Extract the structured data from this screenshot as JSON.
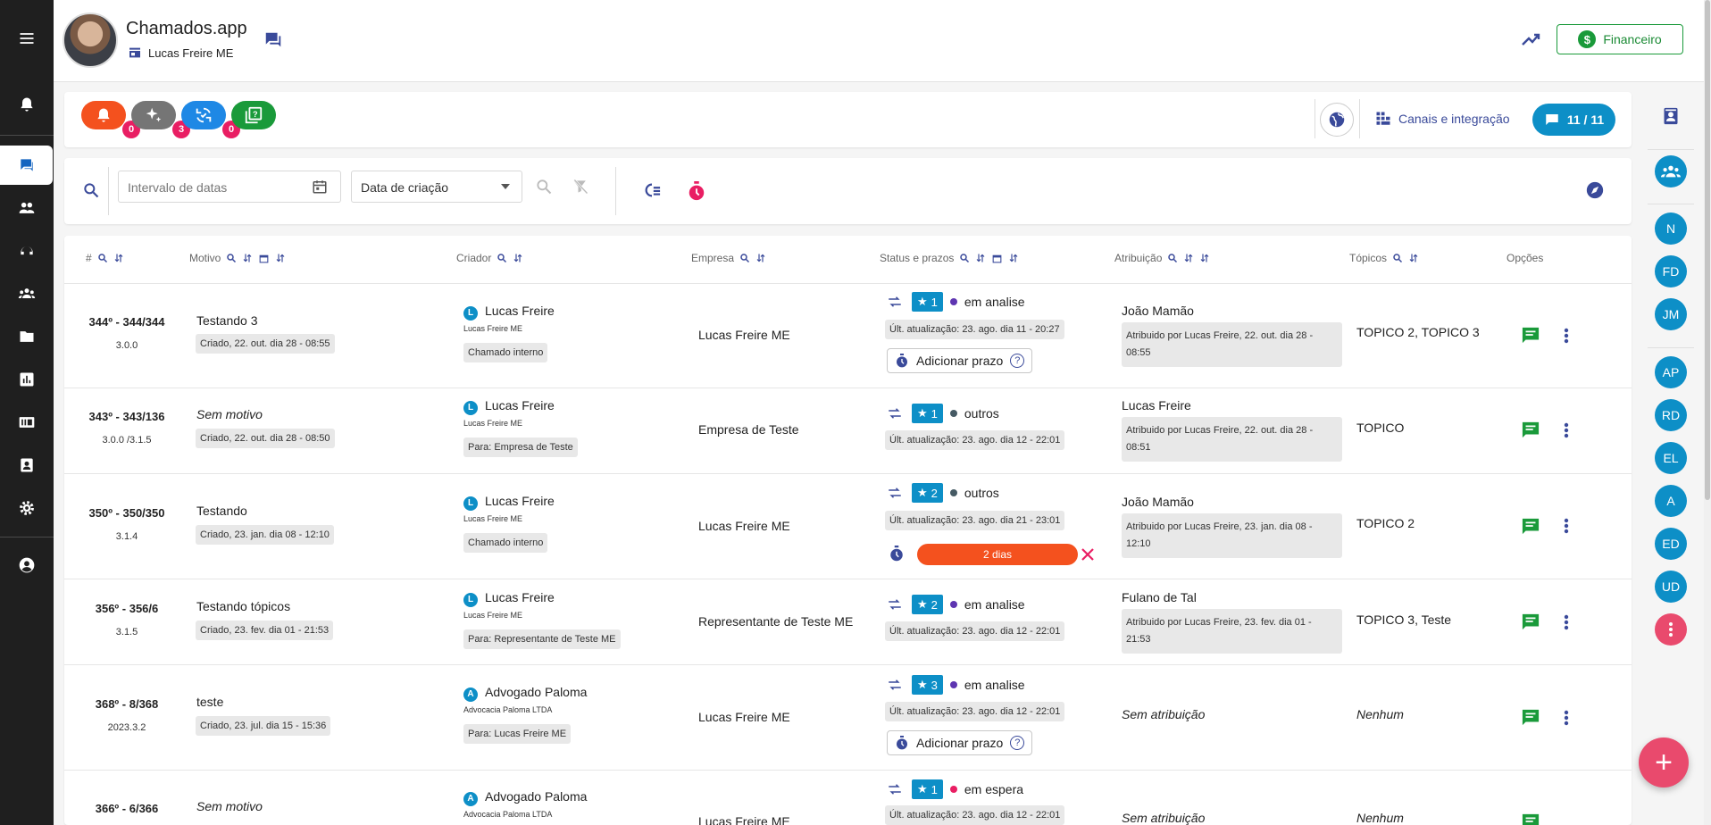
{
  "header": {
    "title": "Chamados.app",
    "company": "Lucas Freire ME",
    "financeiro_label": "Financeiro",
    "financeiro_symbol": "$"
  },
  "notifications": [
    {
      "count": "0",
      "color": "#f4511e",
      "icon": "bell-icon"
    },
    {
      "count": "3",
      "color": "#757575",
      "icon": "sparkle-icon"
    },
    {
      "count": "0",
      "color": "#1e88e5",
      "icon": "sync-icon"
    }
  ],
  "toolbar": {
    "canais_label": "Canais e integração",
    "count_label": "11 / 11"
  },
  "filters": {
    "date_placeholder": "Intervalo de datas",
    "sort_value": "Data de criação"
  },
  "columns": [
    "#",
    "Motivo",
    "Criador",
    "Empresa",
    "Status e prazos",
    "Atribuição",
    "Tópicos",
    "Opções"
  ],
  "rows": [
    {
      "num": "344º - 344/344",
      "version": "3.0.0",
      "motivo": "Testando 3",
      "motivo_italic": false,
      "created": "Criado, 22. out. dia 28 - 08:55",
      "creator_initial": "L",
      "creator": "Lucas Freire",
      "creator_company": "Lucas Freire ME",
      "creator_chip": "Chamado interno",
      "empresa": "Lucas Freire ME",
      "star": "1",
      "status": "em analise",
      "status_color": "#5e35b1",
      "updated": "Últ. atualização: 23. ago. dia 11 - 20:27",
      "prazo": "Adicionar prazo",
      "assignee": "João Mamão",
      "assigned_by": "Atribuido por Lucas Freire, 22. out. dia 28 - 08:55",
      "topicos": "TOPICO 2, TOPICO 3",
      "topicos_italic": false
    },
    {
      "num": "343º - 343/136",
      "version": "3.0.0 /3.1.5",
      "motivo": "Sem motivo",
      "motivo_italic": true,
      "created": "Criado, 22. out. dia 28 - 08:50",
      "creator_initial": "L",
      "creator": "Lucas Freire",
      "creator_company": "Lucas Freire ME",
      "creator_chip": "Para: Empresa de Teste",
      "empresa": "Empresa de Teste",
      "star": "1",
      "status": "outros",
      "status_color": "#455a64",
      "updated": "Últ. atualização: 23. ago. dia 12 - 22:01",
      "prazo": "",
      "assignee": "Lucas Freire",
      "assigned_by": "Atribuido por Lucas Freire, 22. out. dia 28 - 08:51",
      "topicos": "TOPICO",
      "topicos_italic": false
    },
    {
      "num": "350º - 350/350",
      "version": "3.1.4",
      "motivo": "Testando",
      "motivo_italic": false,
      "created": "Criado, 23. jan. dia 08 - 12:10",
      "creator_initial": "L",
      "creator": "Lucas Freire",
      "creator_company": "Lucas Freire ME",
      "creator_chip": "Chamado interno",
      "empresa": "Lucas Freire ME",
      "star": "2",
      "status": "outros",
      "status_color": "#455a64",
      "updated": "Últ. atualização: 23. ago. dia 21 - 23:01",
      "deadline": "2 dias",
      "assignee": "João Mamão",
      "assigned_by": "Atribuido por Lucas Freire, 23. jan. dia 08 - 12:10",
      "topicos": "TOPICO 2",
      "topicos_italic": false
    },
    {
      "num": "356º - 356/6",
      "version": "3.1.5",
      "motivo": "Testando tópicos",
      "motivo_italic": false,
      "created": "Criado, 23. fev. dia 01 - 21:53",
      "creator_initial": "L",
      "creator": "Lucas Freire",
      "creator_company": "Lucas Freire ME",
      "creator_chip": "Para: Representante de Teste ME",
      "empresa": "Representante de Teste ME",
      "star": "2",
      "status": "em analise",
      "status_color": "#5e35b1",
      "updated": "Últ. atualização: 23. ago. dia 12 - 22:01",
      "assignee": "Fulano de Tal",
      "assigned_by": "Atribuido por Lucas Freire, 23. fev. dia 01 - 21:53",
      "topicos": "TOPICO 3, Teste",
      "topicos_italic": false
    },
    {
      "num": "368º - 8/368",
      "version": "2023.3.2",
      "motivo": "teste",
      "motivo_italic": false,
      "created": "Criado, 23. jul. dia 15 - 15:36",
      "creator_initial": "A",
      "creator": "Advogado Paloma",
      "creator_company": "Advocacia Paloma LTDA",
      "creator_chip": "Para: Lucas Freire ME",
      "empresa": "Lucas Freire ME",
      "star": "3",
      "status": "em analise",
      "status_color": "#5e35b1",
      "updated": "Últ. atualização: 23. ago. dia 12 - 22:01",
      "prazo": "Adicionar prazo",
      "assignee": "Sem atribuição",
      "topicos": "Nenhum",
      "topicos_italic": true
    },
    {
      "num": "366º - 6/366",
      "motivo": "Sem motivo",
      "motivo_italic": true,
      "creator_initial": "A",
      "creator": "Advogado Paloma",
      "creator_company": "Advocacia Paloma LTDA",
      "empresa": "Lucas Freire ME",
      "star": "1",
      "status": "em espera",
      "status_color": "#e91e63",
      "updated": "Últ. atualização: 23. ago. dia 12 - 22:01",
      "assignee": "Sem atribuição",
      "topicos": "Nenhum",
      "topicos_italic": true
    }
  ],
  "right_rail": {
    "avatars_a": [
      "N",
      "FD",
      "JM"
    ],
    "avatars_b": [
      "AP",
      "RD",
      "EL",
      "A",
      "ED",
      "UD"
    ]
  },
  "fab_label": "+",
  "colors": {
    "accent": "#0d8fc7",
    "primary_dark": "#3a4a9a",
    "green": "#1a9a3a",
    "pink": "#e91e63",
    "orange": "#f4511e"
  }
}
